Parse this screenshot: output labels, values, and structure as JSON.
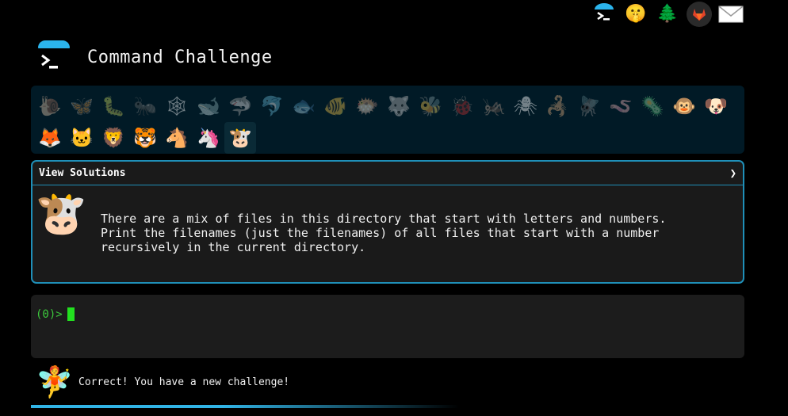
{
  "topbar": {
    "icons": [
      {
        "name": "terminal-umbrella-icon",
        "glyph": ">_"
      },
      {
        "name": "shush-face-icon",
        "glyph": "🤫"
      },
      {
        "name": "tree-icon",
        "glyph": "🌲"
      },
      {
        "name": "gitlab-icon",
        "glyph": "🦊"
      },
      {
        "name": "mail-icon",
        "glyph": "✉"
      }
    ]
  },
  "header": {
    "title": "Command Challenge"
  },
  "animals": [
    {
      "name": "snail-icon",
      "glyph": "🐌",
      "state": "todo"
    },
    {
      "name": "butterfly-icon",
      "glyph": "🦋",
      "state": "todo"
    },
    {
      "name": "caterpillar-icon",
      "glyph": "🐛",
      "state": "todo"
    },
    {
      "name": "ant-icon",
      "glyph": "🐜",
      "state": "todo"
    },
    {
      "name": "spider-web-icon",
      "glyph": "🕸",
      "state": "todo"
    },
    {
      "name": "whale-icon",
      "glyph": "🐋",
      "state": "todo"
    },
    {
      "name": "shark-icon",
      "glyph": "🦈",
      "state": "todo"
    },
    {
      "name": "dolphin-icon",
      "glyph": "🐬",
      "state": "todo"
    },
    {
      "name": "fish-icon",
      "glyph": "🐟",
      "state": "todo"
    },
    {
      "name": "tropical-fish-icon",
      "glyph": "🐠",
      "state": "todo"
    },
    {
      "name": "blowfish-icon",
      "glyph": "🐡",
      "state": "todo"
    },
    {
      "name": "wolf-icon",
      "glyph": "🐺",
      "state": "todo"
    },
    {
      "name": "bee-icon",
      "glyph": "🐝",
      "state": "todo"
    },
    {
      "name": "ladybug-icon",
      "glyph": "🐞",
      "state": "todo"
    },
    {
      "name": "cricket-icon",
      "glyph": "🦗",
      "state": "todo"
    },
    {
      "name": "spider-icon",
      "glyph": "🕷",
      "state": "todo"
    },
    {
      "name": "scorpion-icon",
      "glyph": "🦂",
      "state": "todo"
    },
    {
      "name": "fly-icon",
      "glyph": "🪰",
      "state": "todo"
    },
    {
      "name": "worm-icon",
      "glyph": "🪱",
      "state": "todo"
    },
    {
      "name": "microbe-icon",
      "glyph": "🦠",
      "state": "todo"
    },
    {
      "name": "monkey-icon",
      "glyph": "🐵",
      "state": "done"
    },
    {
      "name": "dog-icon",
      "glyph": "🐶",
      "state": "done"
    },
    {
      "name": "fox-icon",
      "glyph": "🦊",
      "state": "done"
    },
    {
      "name": "cat-icon",
      "glyph": "🐱",
      "state": "done"
    },
    {
      "name": "lion-icon",
      "glyph": "🦁",
      "state": "done"
    },
    {
      "name": "tiger-icon",
      "glyph": "🐯",
      "state": "done"
    },
    {
      "name": "horse-icon",
      "glyph": "🐴",
      "state": "done"
    },
    {
      "name": "unicorn-icon",
      "glyph": "🦄",
      "state": "done"
    },
    {
      "name": "cow-icon",
      "glyph": "🐮",
      "state": "current"
    }
  ],
  "challenge": {
    "solutions_label": "View Solutions",
    "chevron": "❯",
    "animal_glyph": "🐮",
    "description": "There are a mix of files in this directory that start with letters and numbers.\nPrint the filenames (just the filenames) of all files that start with a number\nrecursively in the current directory."
  },
  "terminal": {
    "prompt": "(0)>"
  },
  "status": {
    "fairy_glyph": "🧚",
    "message": "Correct! You have a new challenge!"
  },
  "colors": {
    "accent": "#1f8fb8",
    "cursor": "#22e01f",
    "prompt": "#3cc83c",
    "strip_bg": "#011a26"
  }
}
